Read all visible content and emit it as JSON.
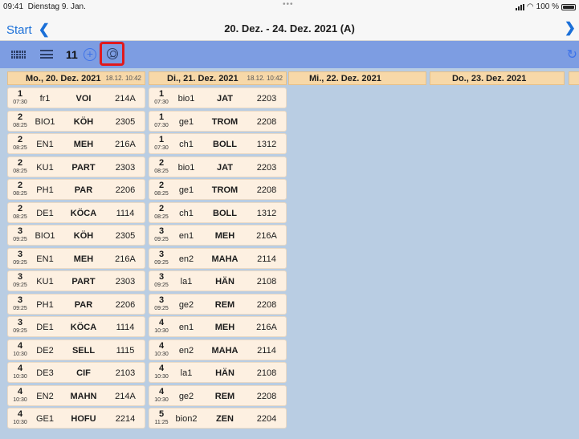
{
  "status": {
    "time": "09:41",
    "date": "Dienstag 9. Jan.",
    "dots": "•••",
    "battery": "100 %"
  },
  "nav": {
    "back_label": "Start",
    "title": "20. Dez. - 24. Dez. 2021 (A)"
  },
  "toolbar": {
    "count": "11"
  },
  "days": [
    {
      "name": "Mo., 20. Dez. 2021",
      "stamp": "18.12. 10:42"
    },
    {
      "name": "Di., 21. Dez. 2021",
      "stamp": "18.12. 10:42"
    },
    {
      "name": "Mi., 22. Dez. 2021",
      "stamp": ""
    },
    {
      "name": "Do., 23. Dez. 2021",
      "stamp": ""
    }
  ],
  "monday": [
    {
      "period": "1",
      "time": "07:30",
      "subject": "fr1",
      "teacher": "VOI",
      "room": "214A"
    },
    {
      "period": "2",
      "time": "08:25",
      "subject": "BIO1",
      "teacher": "KÖH",
      "room": "2305"
    },
    {
      "period": "2",
      "time": "08:25",
      "subject": "EN1",
      "teacher": "MEH",
      "room": "216A"
    },
    {
      "period": "2",
      "time": "08:25",
      "subject": "KU1",
      "teacher": "PART",
      "room": "2303"
    },
    {
      "period": "2",
      "time": "08:25",
      "subject": "PH1",
      "teacher": "PAR",
      "room": "2206"
    },
    {
      "period": "2",
      "time": "08:25",
      "subject": "DE1",
      "teacher": "KÖCA",
      "room": "1114"
    },
    {
      "period": "3",
      "time": "09:25",
      "subject": "BIO1",
      "teacher": "KÖH",
      "room": "2305"
    },
    {
      "period": "3",
      "time": "09:25",
      "subject": "EN1",
      "teacher": "MEH",
      "room": "216A"
    },
    {
      "period": "3",
      "time": "09:25",
      "subject": "KU1",
      "teacher": "PART",
      "room": "2303"
    },
    {
      "period": "3",
      "time": "09:25",
      "subject": "PH1",
      "teacher": "PAR",
      "room": "2206"
    },
    {
      "period": "3",
      "time": "09:25",
      "subject": "DE1",
      "teacher": "KÖCA",
      "room": "1114"
    },
    {
      "period": "4",
      "time": "10:30",
      "subject": "DE2",
      "teacher": "SELL",
      "room": "1115"
    },
    {
      "period": "4",
      "time": "10:30",
      "subject": "DE3",
      "teacher": "CIF",
      "room": "2103"
    },
    {
      "period": "4",
      "time": "10:30",
      "subject": "EN2",
      "teacher": "MAHN",
      "room": "214A"
    },
    {
      "period": "4",
      "time": "10:30",
      "subject": "GE1",
      "teacher": "HOFU",
      "room": "2214"
    }
  ],
  "tuesday": [
    {
      "period": "1",
      "time": "07:30",
      "subject": "bio1",
      "teacher": "JAT",
      "room": "2203"
    },
    {
      "period": "1",
      "time": "07:30",
      "subject": "ge1",
      "teacher": "TROM",
      "room": "2208"
    },
    {
      "period": "1",
      "time": "07:30",
      "subject": "ch1",
      "teacher": "BOLL",
      "room": "1312"
    },
    {
      "period": "2",
      "time": "08:25",
      "subject": "bio1",
      "teacher": "JAT",
      "room": "2203"
    },
    {
      "period": "2",
      "time": "08:25",
      "subject": "ge1",
      "teacher": "TROM",
      "room": "2208"
    },
    {
      "period": "2",
      "time": "08:25",
      "subject": "ch1",
      "teacher": "BOLL",
      "room": "1312"
    },
    {
      "period": "3",
      "time": "09:25",
      "subject": "en1",
      "teacher": "MEH",
      "room": "216A"
    },
    {
      "period": "3",
      "time": "09:25",
      "subject": "en2",
      "teacher": "MAHA",
      "room": "2114"
    },
    {
      "period": "3",
      "time": "09:25",
      "subject": "la1",
      "teacher": "HÄN",
      "room": "2108"
    },
    {
      "period": "3",
      "time": "09:25",
      "subject": "ge2",
      "teacher": "REM",
      "room": "2208"
    },
    {
      "period": "4",
      "time": "10:30",
      "subject": "en1",
      "teacher": "MEH",
      "room": "216A"
    },
    {
      "period": "4",
      "time": "10:30",
      "subject": "en2",
      "teacher": "MAHA",
      "room": "2114"
    },
    {
      "period": "4",
      "time": "10:30",
      "subject": "la1",
      "teacher": "HÄN",
      "room": "2108"
    },
    {
      "period": "4",
      "time": "10:30",
      "subject": "ge2",
      "teacher": "REM",
      "room": "2208"
    },
    {
      "period": "5",
      "time": "11:25",
      "subject": "bion2",
      "teacher": "ZEN",
      "room": "2204"
    }
  ]
}
